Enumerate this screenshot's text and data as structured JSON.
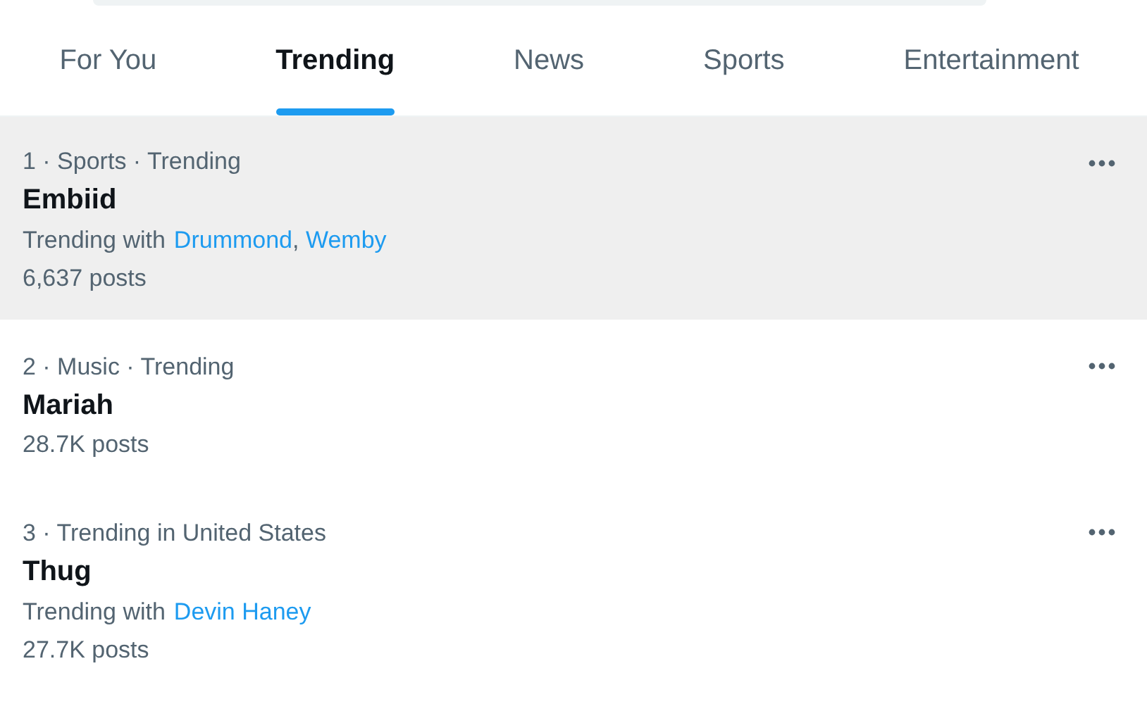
{
  "tabs": [
    {
      "label": "For You",
      "selected": false
    },
    {
      "label": "Trending",
      "selected": true
    },
    {
      "label": "News",
      "selected": false
    },
    {
      "label": "Sports",
      "selected": false
    },
    {
      "label": "Entertainment",
      "selected": false
    }
  ],
  "trends": [
    {
      "meta": "1 · Sports · Trending",
      "title": "Embiid",
      "highlighted": true,
      "related_label": "Trending with",
      "related": [
        "Drummond",
        "Wemby"
      ],
      "separator": ",",
      "posts": "6,637 posts"
    },
    {
      "meta": "2 · Music · Trending",
      "title": "Mariah",
      "highlighted": false,
      "posts": "28.7K posts"
    },
    {
      "meta": "3 · Trending in United States",
      "title": "Thug",
      "highlighted": false,
      "related_label": "Trending with",
      "related": [
        "Devin Haney"
      ],
      "posts": "27.7K posts"
    }
  ]
}
